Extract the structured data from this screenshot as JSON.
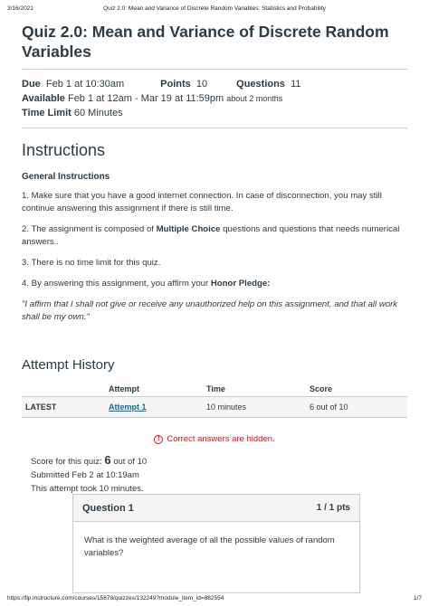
{
  "print": {
    "date": "3/16/2021",
    "title": "Quiz 2.0: Mean and Variance of Discrete Random Variables: Statistics and Probability",
    "url": "https://fip.instructure.com/courses/15878/quizzes/132249?module_item_id=882554",
    "page": "1/7"
  },
  "quiz": {
    "title": "Quiz 2.0: Mean and Variance of Discrete Random Variables",
    "due_label": "Due",
    "due_value": "Feb 1 at 10:30am",
    "points_label": "Points",
    "points_value": "10",
    "questions_label": "Questions",
    "questions_value": "11",
    "available_label": "Available",
    "available_value": "Feb 1 at 12am - Mar 19 at 11:59pm",
    "available_note": "about 2 months",
    "time_limit_label": "Time Limit",
    "time_limit_value": "60 Minutes"
  },
  "instructions": {
    "heading": "Instructions",
    "general": "General Instructions",
    "p1": "1. Make sure that you have a good internet connection. In case of disconnection, you may still continue answering this assignment if there is still time.",
    "p2_a": "2. The assignment is composed of ",
    "p2_b": "Multiple Choice",
    "p2_c": " questions and questions that needs numerical answers..",
    "p3": "3. There is no time limit for this quiz.",
    "p4_a": "4. By answering this assignment, you affirm your ",
    "p4_b": "Honor Pledge:",
    "pledge": "\"I affirm that I shall not give or receive any unauthorized help on this assignment, and that all work shall be my own.\""
  },
  "history": {
    "heading": "Attempt History",
    "columns": [
      "",
      "Attempt",
      "Time",
      "Score"
    ],
    "row": {
      "label": "LATEST",
      "attempt": "Attempt 1",
      "time": "10 minutes",
      "score": "6 out of 10"
    }
  },
  "result": {
    "hidden": "Correct answers are hidden.",
    "score_prefix": "Score for this quiz:",
    "score_value": "6",
    "score_suffix": "out of 10",
    "submitted": "Submitted Feb 2 at 10:19am",
    "took": "This attempt took 10 minutes."
  },
  "question1": {
    "title": "Question 1",
    "points": "1 / 1 pts",
    "text": "What is the weighted average of all the possible values of random variables?"
  },
  "colors": {
    "link": "#0770a3",
    "alert": "#ee0612",
    "text": "#2d3b45"
  }
}
